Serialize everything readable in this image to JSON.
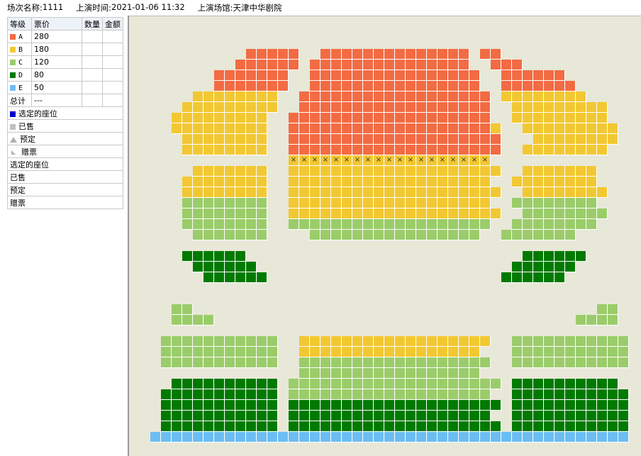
{
  "header": {
    "show_name_label": "场次名称:",
    "show_name": "1111",
    "time_label": "上演时间:",
    "time": "2021-01-06 11:32",
    "venue_label": "上演场馆:",
    "venue": "天津中华剧院"
  },
  "legend": {
    "columns": [
      "等级",
      "票价",
      "数量",
      "金额"
    ],
    "grades": [
      {
        "grade": "A",
        "price": "280",
        "color": "#f26b43"
      },
      {
        "grade": "B",
        "price": "180",
        "color": "#f2c832"
      },
      {
        "grade": "C",
        "price": "120",
        "color": "#9bcc6a"
      },
      {
        "grade": "D",
        "price": "80",
        "color": "#007a00"
      },
      {
        "grade": "E",
        "price": "50",
        "color": "#6cbef2"
      }
    ],
    "total_label": "总计",
    "total_value": "---",
    "selected_label": "选定的座位",
    "sold_label": "已售",
    "reserved_label": "预定",
    "gift_label": "赠票",
    "selected_color": "#0000cc",
    "sold_color": "#c0c0c0",
    "summary_rows": [
      "选定的座位",
      "已售",
      "预定",
      "赠票"
    ]
  },
  "seatmap": {
    "background": "#e8e8d8",
    "reserved_mark": "×",
    "reserved_count": 19,
    "icons": [
      "square-icon",
      "triangle-icon",
      "corner-icon"
    ]
  }
}
